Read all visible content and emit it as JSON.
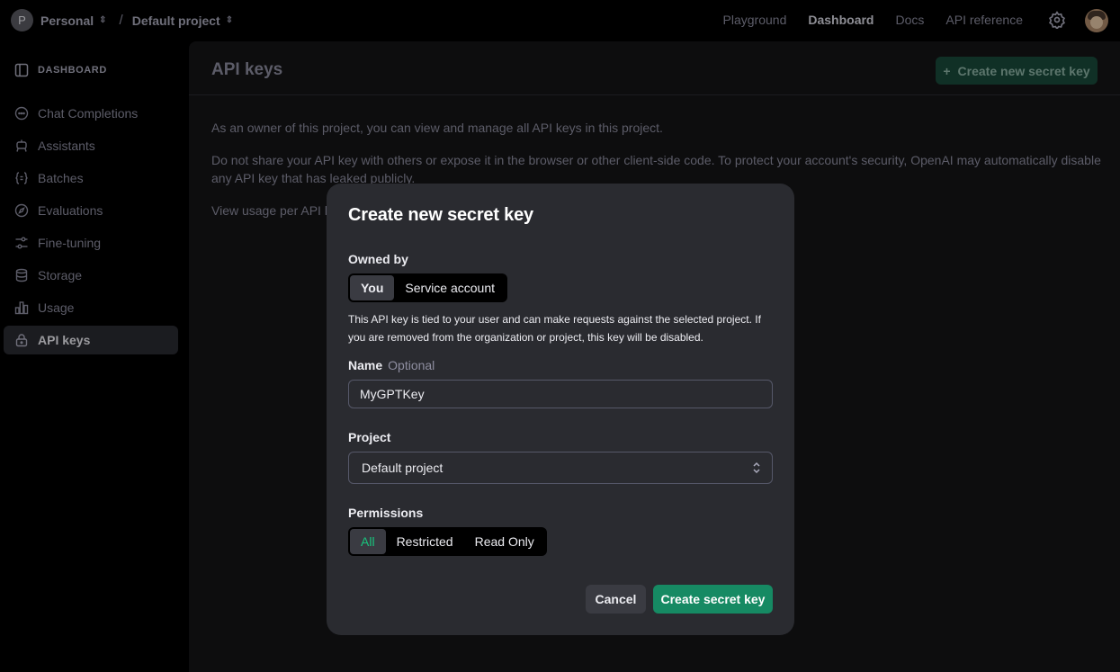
{
  "topbar": {
    "org_initial": "P",
    "org_name": "Personal",
    "project_name": "Default project",
    "nav": [
      "Playground",
      "Dashboard",
      "Docs",
      "API reference"
    ],
    "active_nav": "Dashboard"
  },
  "sidebar": {
    "heading": "DASHBOARD",
    "items": [
      {
        "label": "Chat Completions",
        "icon": "chat-icon"
      },
      {
        "label": "Assistants",
        "icon": "robot-icon"
      },
      {
        "label": "Batches",
        "icon": "braces-icon"
      },
      {
        "label": "Evaluations",
        "icon": "compass-icon"
      },
      {
        "label": "Fine-tuning",
        "icon": "sliders-icon"
      },
      {
        "label": "Storage",
        "icon": "database-icon"
      },
      {
        "label": "Usage",
        "icon": "bar-chart-icon"
      },
      {
        "label": "API keys",
        "icon": "lock-icon",
        "active": true
      }
    ]
  },
  "main": {
    "title": "API keys",
    "create_button": "Create new secret key",
    "paragraphs": [
      "As an owner of this project, you can view and manage all API keys in this project.",
      "Do not share your API key with others or expose it in the browser or other client-side code. To protect your account's security, OpenAI may automatically disable any API key that has leaked publicly.",
      "View usage per API k"
    ]
  },
  "modal": {
    "title": "Create new secret key",
    "owned_by_label": "Owned by",
    "owned_by_options": [
      "You",
      "Service account"
    ],
    "owned_by_selected": "You",
    "owned_by_description": "This API key is tied to your user and can make requests against the selected project. If you are removed from the organization or project, this key will be disabled.",
    "name_label": "Name",
    "name_optional": "Optional",
    "name_value": "MyGPTKey",
    "project_label": "Project",
    "project_value": "Default project",
    "permissions_label": "Permissions",
    "permissions_options": [
      "All",
      "Restricted",
      "Read Only"
    ],
    "permissions_selected": "All",
    "cancel_label": "Cancel",
    "submit_label": "Create secret key"
  },
  "colors": {
    "accent_green": "#19c37d",
    "button_green": "#168a63",
    "modal_bg": "#2a2b30",
    "page_bg": "#000000"
  }
}
